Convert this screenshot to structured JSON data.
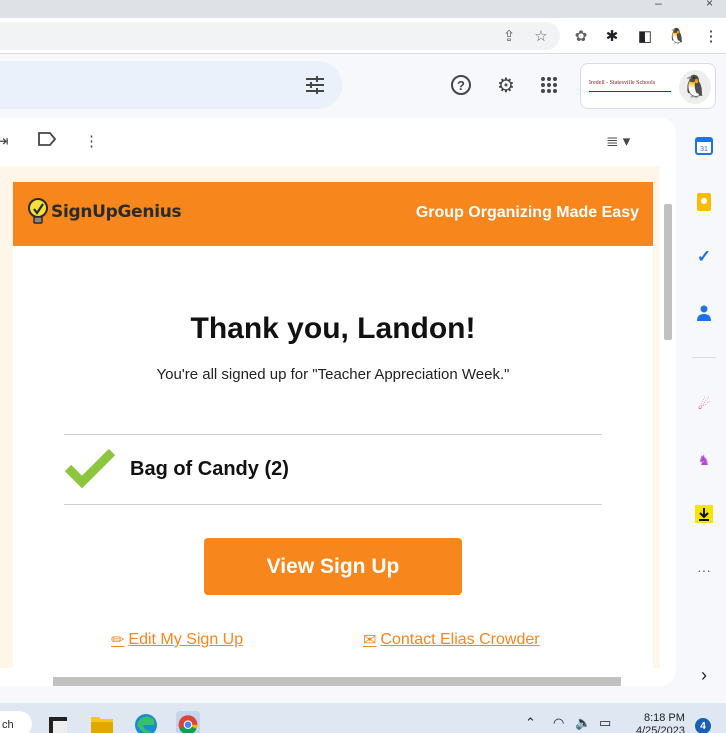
{
  "browser": {
    "icons": [
      "share-icon",
      "star-icon",
      "extension-gear-icon",
      "puzzle-icon",
      "sidepanel-icon",
      "profile-penguin-icon",
      "kebab-menu-icon"
    ]
  },
  "gmail_header": {
    "org_logo_text": "Iredell - Statesville Schools",
    "icons": [
      "search-options-icon",
      "help-icon",
      "settings-icon",
      "apps-grid-icon"
    ]
  },
  "email": {
    "brand": {
      "name": "SignUpGenius",
      "tagline": "Group Organizing Made Easy"
    },
    "heading": "Thank you, Landon!",
    "subtext": "You're all signed up for \"Teacher Appreciation Week.\"",
    "item": "Bag of Candy (2)",
    "button": "View Sign Up",
    "links": {
      "edit": "Edit My Sign Up",
      "contact": "Contact Elias Crowder"
    }
  },
  "side_panel": {
    "icons": [
      "calendar-icon",
      "keep-icon",
      "tasks-icon",
      "contacts-icon",
      "comet-addon-icon",
      "unicorn-addon-icon",
      "download-addon-icon",
      "more-icon",
      "expand-chevron-icon"
    ],
    "calendar_day": "31"
  },
  "taskbar": {
    "search_partial": "ch",
    "time": "8:18 PM",
    "date_partial": "4/25/2023",
    "notification_count": "4"
  },
  "colors": {
    "brand_orange": "#f7861c",
    "email_bg": "#fdf6e9",
    "check_green": "#8cc63f"
  }
}
